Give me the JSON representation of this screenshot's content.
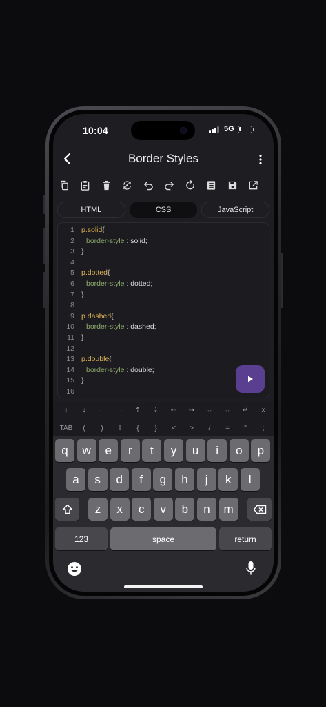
{
  "status_bar": {
    "time": "10:04",
    "network": "5G"
  },
  "header": {
    "title": "Border Styles"
  },
  "toolbar": {
    "buttons": [
      "copy-icon",
      "paste-icon",
      "delete-icon",
      "replace-icon",
      "undo-icon",
      "redo-icon",
      "reset-icon",
      "format-icon",
      "save-icon",
      "open-external-icon"
    ]
  },
  "tabs": [
    {
      "label": "HTML",
      "active": false
    },
    {
      "label": "CSS",
      "active": true
    },
    {
      "label": "JavaScript",
      "active": false
    }
  ],
  "editor": {
    "lines": [
      {
        "n": "1",
        "sel": "p.solid",
        "brace": "{"
      },
      {
        "n": "2",
        "prop": "border-style",
        "sep": " : ",
        "val": "solid;"
      },
      {
        "n": "3",
        "brace": "}"
      },
      {
        "n": "4"
      },
      {
        "n": "5",
        "sel": "p.dotted",
        "brace": "{"
      },
      {
        "n": "6",
        "prop": "border-style",
        "sep": " : ",
        "val": "dotted;"
      },
      {
        "n": "7",
        "brace": "}"
      },
      {
        "n": "8"
      },
      {
        "n": "9",
        "sel": "p.dashed",
        "brace": "{"
      },
      {
        "n": "10",
        "prop": "border-style",
        "sep": " : ",
        "val": "dashed;"
      },
      {
        "n": "11",
        "brace": "}"
      },
      {
        "n": "12"
      },
      {
        "n": "13",
        "sel": "p.double",
        "brace": "{"
      },
      {
        "n": "14",
        "prop": "border-style",
        "sep": " : ",
        "val": "double;"
      },
      {
        "n": "15",
        "brace": "}"
      },
      {
        "n": "16"
      }
    ]
  },
  "symbol_bar": {
    "row1": [
      "↑",
      "↓",
      "←",
      "→",
      "⇡",
      "⇣",
      "⇠",
      "⇢",
      "↔",
      "↔",
      "↵",
      "x"
    ],
    "row2": [
      "TAB",
      "(",
      ")",
      "!",
      "{",
      "}",
      "<",
      ">",
      "/",
      "=",
      "\"",
      ";"
    ]
  },
  "keyboard": {
    "row1": [
      "q",
      "w",
      "e",
      "r",
      "t",
      "y",
      "u",
      "i",
      "o",
      "p"
    ],
    "row2": [
      "a",
      "s",
      "d",
      "f",
      "g",
      "h",
      "j",
      "k",
      "l"
    ],
    "row3": [
      "z",
      "x",
      "c",
      "v",
      "b",
      "n",
      "m"
    ],
    "numbers_label": "123",
    "space_label": "space",
    "return_label": "return"
  },
  "colors": {
    "accent": "#5a3e8f",
    "selector": "#d8b055",
    "property": "#8ca86c"
  }
}
